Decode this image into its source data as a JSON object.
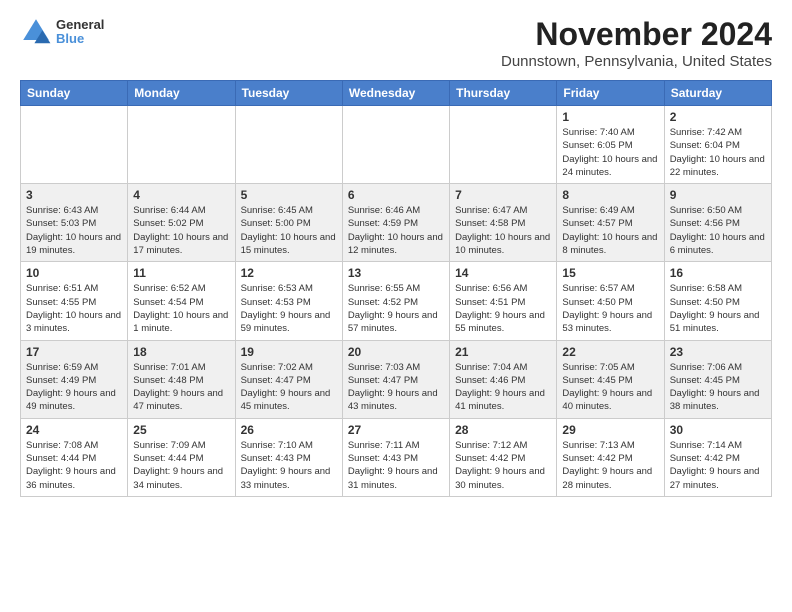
{
  "logo": {
    "line1": "General",
    "line2": "Blue"
  },
  "title": "November 2024",
  "location": "Dunnstown, Pennsylvania, United States",
  "days_of_week": [
    "Sunday",
    "Monday",
    "Tuesday",
    "Wednesday",
    "Thursday",
    "Friday",
    "Saturday"
  ],
  "weeks": [
    [
      {
        "day": "",
        "info": ""
      },
      {
        "day": "",
        "info": ""
      },
      {
        "day": "",
        "info": ""
      },
      {
        "day": "",
        "info": ""
      },
      {
        "day": "",
        "info": ""
      },
      {
        "day": "1",
        "info": "Sunrise: 7:40 AM\nSunset: 6:05 PM\nDaylight: 10 hours and 24 minutes."
      },
      {
        "day": "2",
        "info": "Sunrise: 7:42 AM\nSunset: 6:04 PM\nDaylight: 10 hours and 22 minutes."
      }
    ],
    [
      {
        "day": "3",
        "info": "Sunrise: 6:43 AM\nSunset: 5:03 PM\nDaylight: 10 hours and 19 minutes."
      },
      {
        "day": "4",
        "info": "Sunrise: 6:44 AM\nSunset: 5:02 PM\nDaylight: 10 hours and 17 minutes."
      },
      {
        "day": "5",
        "info": "Sunrise: 6:45 AM\nSunset: 5:00 PM\nDaylight: 10 hours and 15 minutes."
      },
      {
        "day": "6",
        "info": "Sunrise: 6:46 AM\nSunset: 4:59 PM\nDaylight: 10 hours and 12 minutes."
      },
      {
        "day": "7",
        "info": "Sunrise: 6:47 AM\nSunset: 4:58 PM\nDaylight: 10 hours and 10 minutes."
      },
      {
        "day": "8",
        "info": "Sunrise: 6:49 AM\nSunset: 4:57 PM\nDaylight: 10 hours and 8 minutes."
      },
      {
        "day": "9",
        "info": "Sunrise: 6:50 AM\nSunset: 4:56 PM\nDaylight: 10 hours and 6 minutes."
      }
    ],
    [
      {
        "day": "10",
        "info": "Sunrise: 6:51 AM\nSunset: 4:55 PM\nDaylight: 10 hours and 3 minutes."
      },
      {
        "day": "11",
        "info": "Sunrise: 6:52 AM\nSunset: 4:54 PM\nDaylight: 10 hours and 1 minute."
      },
      {
        "day": "12",
        "info": "Sunrise: 6:53 AM\nSunset: 4:53 PM\nDaylight: 9 hours and 59 minutes."
      },
      {
        "day": "13",
        "info": "Sunrise: 6:55 AM\nSunset: 4:52 PM\nDaylight: 9 hours and 57 minutes."
      },
      {
        "day": "14",
        "info": "Sunrise: 6:56 AM\nSunset: 4:51 PM\nDaylight: 9 hours and 55 minutes."
      },
      {
        "day": "15",
        "info": "Sunrise: 6:57 AM\nSunset: 4:50 PM\nDaylight: 9 hours and 53 minutes."
      },
      {
        "day": "16",
        "info": "Sunrise: 6:58 AM\nSunset: 4:50 PM\nDaylight: 9 hours and 51 minutes."
      }
    ],
    [
      {
        "day": "17",
        "info": "Sunrise: 6:59 AM\nSunset: 4:49 PM\nDaylight: 9 hours and 49 minutes."
      },
      {
        "day": "18",
        "info": "Sunrise: 7:01 AM\nSunset: 4:48 PM\nDaylight: 9 hours and 47 minutes."
      },
      {
        "day": "19",
        "info": "Sunrise: 7:02 AM\nSunset: 4:47 PM\nDaylight: 9 hours and 45 minutes."
      },
      {
        "day": "20",
        "info": "Sunrise: 7:03 AM\nSunset: 4:47 PM\nDaylight: 9 hours and 43 minutes."
      },
      {
        "day": "21",
        "info": "Sunrise: 7:04 AM\nSunset: 4:46 PM\nDaylight: 9 hours and 41 minutes."
      },
      {
        "day": "22",
        "info": "Sunrise: 7:05 AM\nSunset: 4:45 PM\nDaylight: 9 hours and 40 minutes."
      },
      {
        "day": "23",
        "info": "Sunrise: 7:06 AM\nSunset: 4:45 PM\nDaylight: 9 hours and 38 minutes."
      }
    ],
    [
      {
        "day": "24",
        "info": "Sunrise: 7:08 AM\nSunset: 4:44 PM\nDaylight: 9 hours and 36 minutes."
      },
      {
        "day": "25",
        "info": "Sunrise: 7:09 AM\nSunset: 4:44 PM\nDaylight: 9 hours and 34 minutes."
      },
      {
        "day": "26",
        "info": "Sunrise: 7:10 AM\nSunset: 4:43 PM\nDaylight: 9 hours and 33 minutes."
      },
      {
        "day": "27",
        "info": "Sunrise: 7:11 AM\nSunset: 4:43 PM\nDaylight: 9 hours and 31 minutes."
      },
      {
        "day": "28",
        "info": "Sunrise: 7:12 AM\nSunset: 4:42 PM\nDaylight: 9 hours and 30 minutes."
      },
      {
        "day": "29",
        "info": "Sunrise: 7:13 AM\nSunset: 4:42 PM\nDaylight: 9 hours and 28 minutes."
      },
      {
        "day": "30",
        "info": "Sunrise: 7:14 AM\nSunset: 4:42 PM\nDaylight: 9 hours and 27 minutes."
      }
    ]
  ]
}
